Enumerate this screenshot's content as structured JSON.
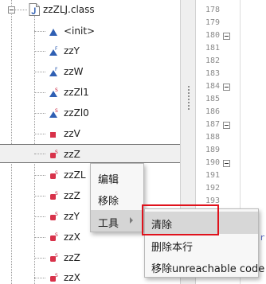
{
  "tree": {
    "class_node": {
      "label": "zzZLJ.class",
      "icon": "java-class-file-icon"
    },
    "members": [
      {
        "label": "<init>",
        "icon": "blue-triangle-icon"
      },
      {
        "label": "zzY",
        "icon": "field-final-icon"
      },
      {
        "label": "zzW",
        "icon": "field-final-icon"
      },
      {
        "label": "zzZl1",
        "icon": "field-static-icon"
      },
      {
        "label": "zzZl0",
        "icon": "field-static-icon"
      },
      {
        "label": "zzV",
        "icon": "red-square-icon"
      },
      {
        "label": "zzZ",
        "icon": "method-static-icon",
        "selected": true
      },
      {
        "label": "zzZL",
        "icon": "method-static-icon"
      },
      {
        "label": "zzZ",
        "icon": "method-static-icon"
      },
      {
        "label": "zzY",
        "icon": "method-static-icon"
      },
      {
        "label": "zzX",
        "icon": "method-static-icon"
      },
      {
        "label": "zzZ",
        "icon": "method-static-icon"
      },
      {
        "label": "zzX",
        "icon": "method-static-icon"
      }
    ]
  },
  "editor": {
    "line_numbers": [
      "178",
      "179",
      "180",
      "181",
      "182",
      "183",
      "184",
      "185",
      "186",
      "187",
      "188",
      "189",
      "190",
      "191",
      "192",
      "193"
    ],
    "fold_markers_at": [
      "180",
      "184",
      "187",
      "190"
    ],
    "code_fragment": "r:"
  },
  "context_menu": {
    "items": [
      {
        "label": "编辑"
      },
      {
        "label": "移除"
      },
      {
        "label": "工具",
        "has_submenu": true,
        "active": true
      }
    ]
  },
  "submenu": {
    "items": [
      {
        "label": "清除",
        "highlighted": true
      },
      {
        "label": "删除本行"
      },
      {
        "label": "移除unreachable code"
      }
    ]
  },
  "colors": {
    "highlight_box": "#e0121c",
    "menu_background": "#f7f7f7",
    "menu_hover": "#d5d5d5",
    "icon_blue": "#2f5fb3",
    "icon_red": "#d8324a"
  }
}
